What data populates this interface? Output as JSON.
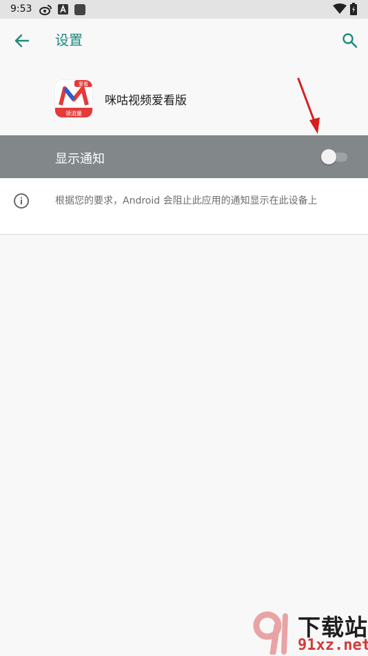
{
  "status_bar": {
    "time": "9:53",
    "icons": [
      "weibo-icon",
      "a-badge-icon",
      "square-icon",
      "wifi-icon",
      "battery-charging-icon"
    ]
  },
  "app_bar": {
    "title": "设置",
    "back_icon": "arrow-left-icon",
    "search_icon": "search-icon",
    "accent": "#1e8a7d"
  },
  "app": {
    "name": "咪咕视频爱看版",
    "icon_badge": "爱看",
    "icon_caption": "领流量"
  },
  "notification": {
    "label": "显示通知",
    "enabled": false,
    "row_color": "#82878a"
  },
  "info": {
    "icon": "info-icon",
    "text": "根据您的要求，Android 会阻止此应用的通知显示在此设备上"
  },
  "annotation": {
    "color": "#d81e1e"
  },
  "watermark": {
    "title": "下载站",
    "domain": "91xz.net"
  }
}
